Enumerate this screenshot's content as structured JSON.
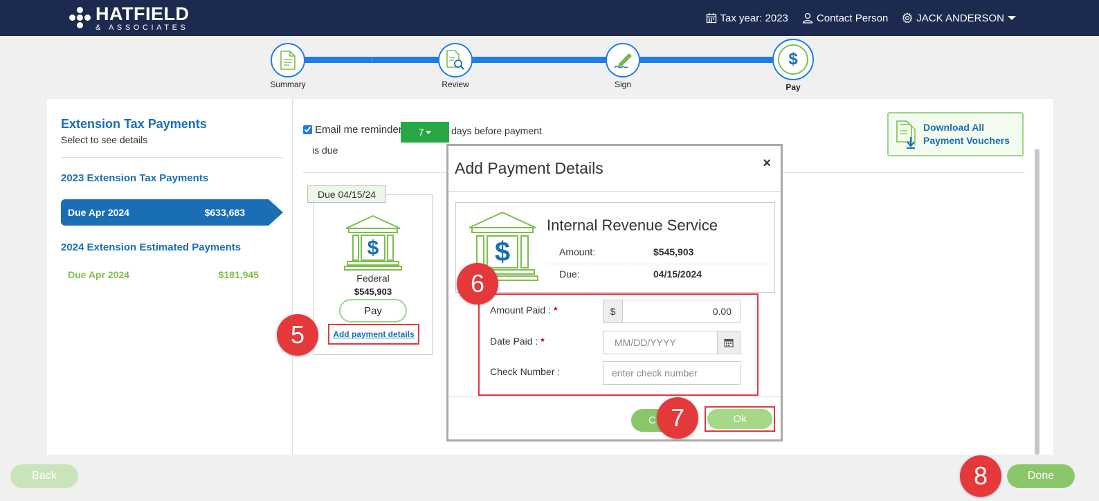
{
  "header": {
    "logo_main": "HATFIELD",
    "logo_sub": "& ASSOCIATES",
    "tax_year": "Tax year: 2023",
    "contact": "Contact Person",
    "user": "JACK ANDERSON"
  },
  "stepper": {
    "steps": [
      {
        "label": "Summary",
        "icon": "document-icon"
      },
      {
        "label": "Review",
        "icon": "document-search-icon"
      },
      {
        "label": "Sign",
        "icon": "pen-sign-icon"
      },
      {
        "label": "Pay",
        "icon": "dollar-icon"
      }
    ],
    "active": "Pay"
  },
  "sidebar": {
    "title": "Extension Tax Payments",
    "subtitle": "Select to see details",
    "section1": "2023 Extension Tax Payments",
    "item_active": {
      "label": "Due Apr 2024",
      "amount": "$633,683"
    },
    "section2": "2024 Extension Estimated Payments",
    "item2": {
      "label": "Due Apr 2024",
      "amount": "$181,945"
    }
  },
  "content": {
    "reminder_label": "Email me reminder",
    "reminder_checked": true,
    "reminder_days": "7",
    "days_after": "days before payment",
    "is_due": "is due",
    "download_line1": "Download All",
    "download_line2": "Payment Vouchers"
  },
  "card": {
    "due_tag": "Due 04/15/24",
    "type": "Federal",
    "amount": "$545,903",
    "pay_label": "Pay",
    "add_link": "Add payment details"
  },
  "modal": {
    "title": "Add Payment Details",
    "close": "×",
    "agency": "Internal Revenue Service",
    "amount_key": "Amount:",
    "amount_val": "$545,903",
    "due_key": "Due:",
    "due_val": "04/15/2024",
    "amount_paid_label": "Amount Paid :",
    "amount_paid_prefix": "$",
    "amount_paid_value": "0.00",
    "date_paid_label": "Date Paid :",
    "date_placeholder": "MM/DD/YYYY",
    "check_label": "Check Number :",
    "check_placeholder": "enter check number",
    "required_mark": "*",
    "cancel_label": "C",
    "ok_label": "Ok"
  },
  "markers": {
    "m5": "5",
    "m6": "6",
    "m7": "7",
    "m8": "8"
  },
  "footer": {
    "back": "Back",
    "done": "Done"
  },
  "colors": {
    "navy": "#1b2a4e",
    "blue": "#1a6fb4",
    "green": "#8ac66a",
    "red": "#e5383b"
  }
}
